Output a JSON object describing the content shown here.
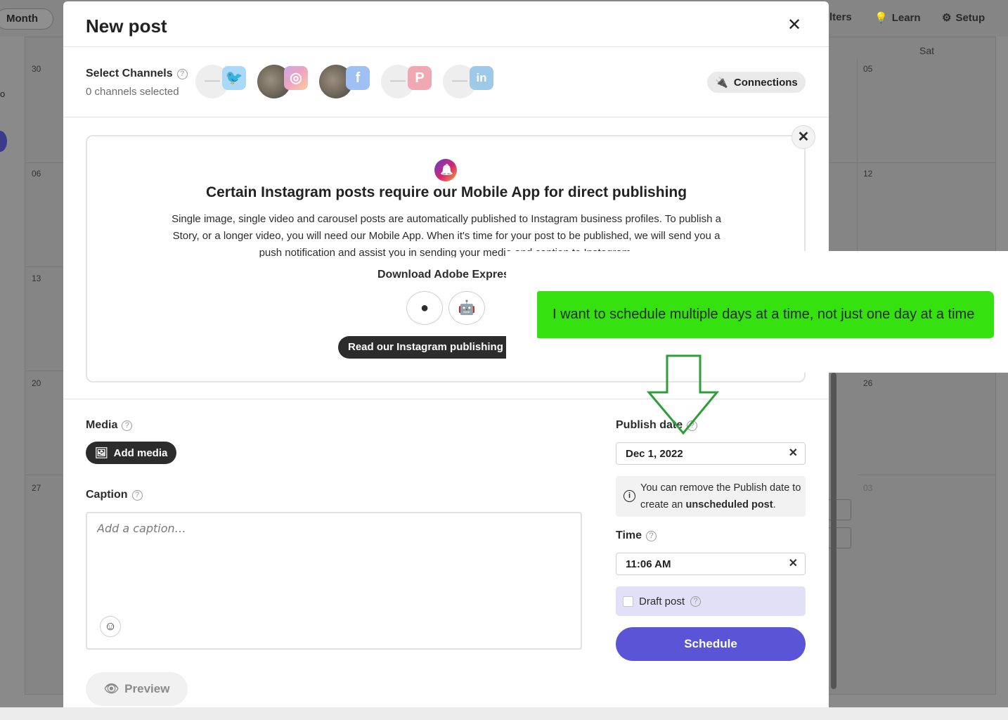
{
  "background": {
    "view_button": "Month",
    "top_items": [
      "lters",
      "Learn",
      "Setup"
    ],
    "weekday": "Sat",
    "left_dates": [
      "30",
      "06",
      "13",
      "20",
      "27"
    ],
    "right_dates": [
      "05",
      "12",
      "26",
      "03"
    ],
    "edge_char": "o"
  },
  "modal": {
    "title": "New post",
    "channels": {
      "label": "Select Channels",
      "count_text": "0 channels selected",
      "items": [
        {
          "name": "twitter",
          "badge": "twitter-icon",
          "color": "#1da1f2"
        },
        {
          "name": "instagram",
          "badge": "instagram-icon",
          "color": "#d6266e"
        },
        {
          "name": "facebook",
          "badge": "facebook-icon",
          "color": "#1877f2"
        },
        {
          "name": "pinterest",
          "badge": "pinterest-icon",
          "color": "#e60023"
        },
        {
          "name": "linkedin",
          "badge": "linkedin-icon",
          "color": "#0a66c2"
        }
      ],
      "connections_label": "Connections"
    },
    "notice": {
      "title": "Certain Instagram posts require our Mobile App for direct publishing",
      "body": "Single image, single video and carousel posts are automatically published to Instagram business profiles. To publish a Story, or a longer video, you will need our Mobile App. When it's time for your post to be published, we will send you a push notification and assist you in sending your media and caption to Instagram.",
      "download_label": "Download Adobe Express",
      "guide_button": "Read our Instagram publishing guide"
    },
    "media": {
      "label": "Media",
      "add_button": "Add media"
    },
    "caption": {
      "label": "Caption",
      "placeholder": "Add a caption…"
    },
    "preview_button": "Preview",
    "publish_date": {
      "label": "Publish date",
      "value": "Dec 1, 2022",
      "info_prefix": "You can remove the Publish date to create an ",
      "info_bold": "unscheduled post",
      "info_suffix": "."
    },
    "time": {
      "label": "Time",
      "value": "11:06 AM"
    },
    "draft_label": "Draft post",
    "schedule_button": "Schedule"
  },
  "annotation": {
    "note": "I want to schedule multiple days at a time, not just one day at a time",
    "color": "#35e210",
    "arrow_color": "#2e9e3a"
  },
  "colors": {
    "accent": "#5a55d6",
    "draft_bg": "#e2e0f7"
  }
}
